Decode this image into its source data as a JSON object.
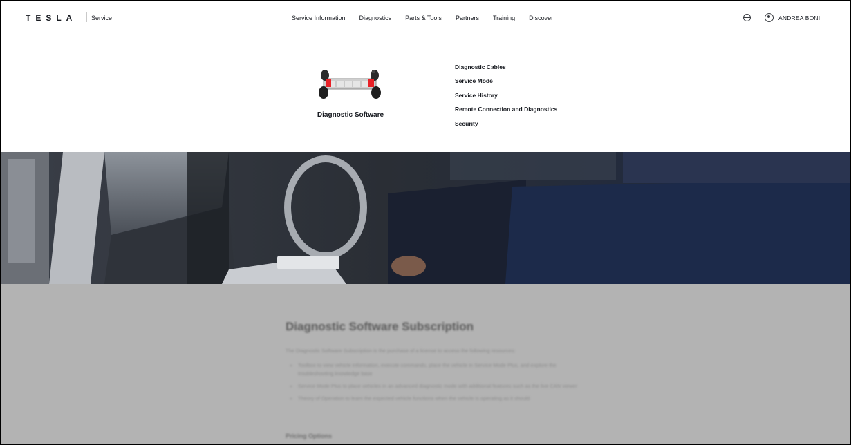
{
  "header": {
    "logo": "TESLA",
    "section": "Service",
    "nav": [
      "Service Information",
      "Diagnostics",
      "Parts & Tools",
      "Partners",
      "Training",
      "Discover"
    ],
    "user_name": "ANDREA BONI"
  },
  "dropdown": {
    "card_title": "Diagnostic Software",
    "links": [
      "Diagnostic Cables",
      "Service Mode",
      "Service History",
      "Remote Connection and Diagnostics",
      "Security"
    ]
  },
  "content": {
    "heading": "Diagnostic Software Subscription",
    "intro": "The Diagnostic Software Subscription is the purchase of a license to access the following resources:",
    "bullets": [
      "Toolbox to view vehicle information, execute commands, place the vehicle in Service Mode Plus, and explore the troubleshooting knowledge base",
      "Service Mode Plus to place vehicles in an advanced diagnostic mode with additional features such as the live CAN viewer",
      "Theory of Operation to learn the expected vehicle functions when the vehicle is operating as it should"
    ],
    "pricing_heading": "Pricing Options"
  },
  "colors": {
    "text_primary": "#171a20",
    "overlay": "#b3b3b3",
    "accent_red": "#e82127"
  },
  "icons": [
    "globe-icon",
    "user-circle-icon",
    "vehicle-chassis-image"
  ]
}
